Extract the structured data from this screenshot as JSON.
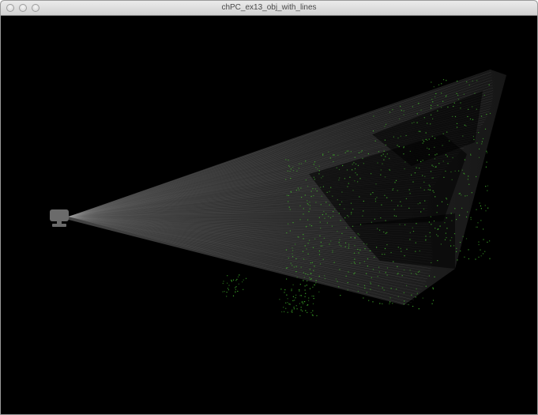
{
  "window": {
    "title": "chPC_ex13_obj_with_lines"
  },
  "traffic_lights": [
    "close-icon",
    "minimize-icon",
    "zoom-icon"
  ],
  "scene": {
    "background_color": "#000000",
    "fan_color": "#9a9a9a",
    "point_color": "#3fae2a",
    "camera_icon": "camera-icon",
    "camera_color": "#6b6b6b"
  }
}
